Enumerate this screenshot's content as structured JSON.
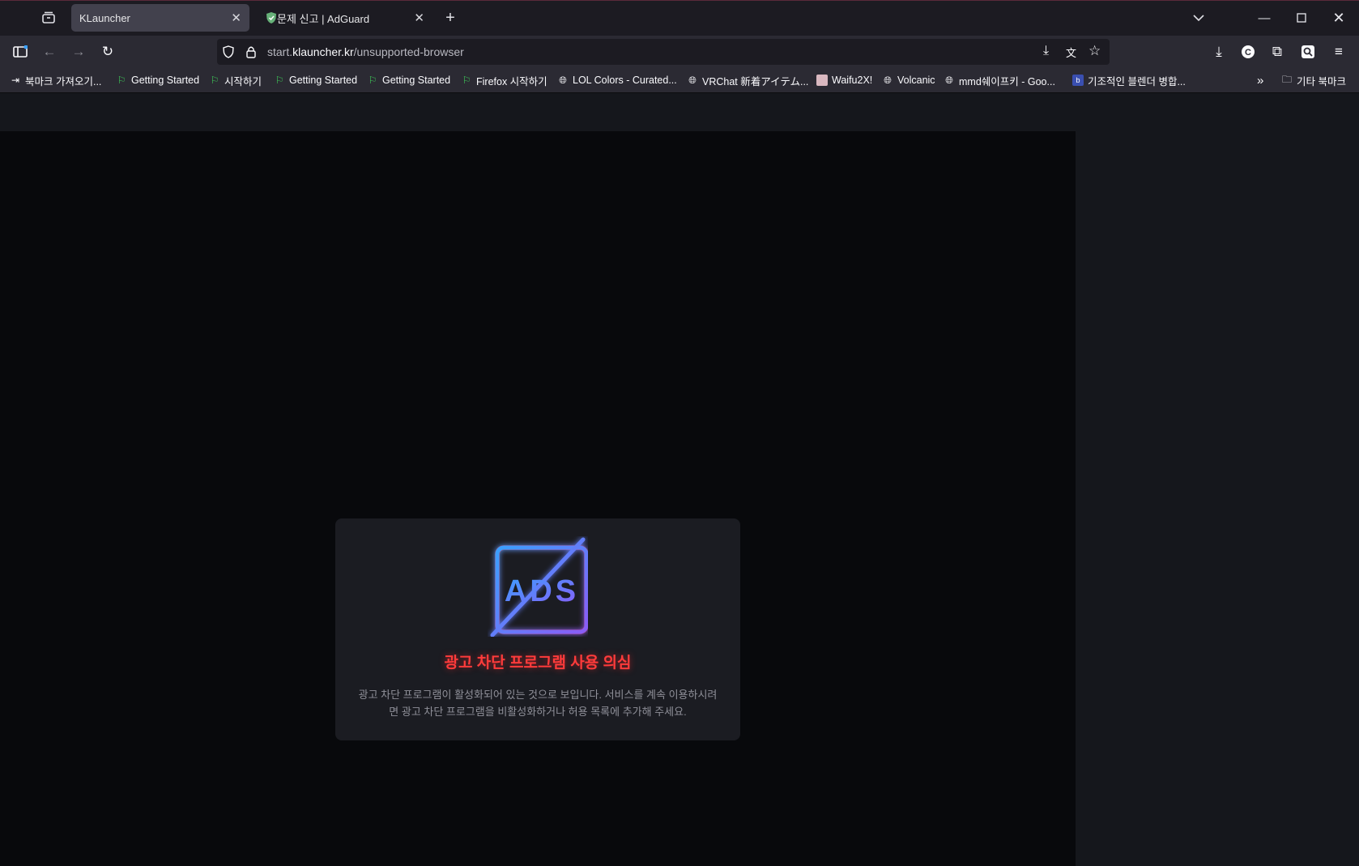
{
  "tabs": [
    {
      "title": "KLauncher",
      "active": true
    },
    {
      "title": "문제 신고 | AdGuard",
      "active": false
    }
  ],
  "address": {
    "prefix": "start.",
    "domain": "klauncher.kr",
    "path": "/unsupported-browser"
  },
  "bookmarks": [
    {
      "label": "북마크 가져오기...",
      "icon": "import-icon"
    },
    {
      "label": "Getting Started",
      "icon": "firefox-flag-icon"
    },
    {
      "label": "시작하기",
      "icon": "firefox-flag-icon"
    },
    {
      "label": "Getting Started",
      "icon": "firefox-flag-icon"
    },
    {
      "label": "Getting Started",
      "icon": "firefox-flag-icon"
    },
    {
      "label": "Firefox 시작하기",
      "icon": "firefox-flag-icon"
    },
    {
      "label": "LOL Colors - Curated...",
      "icon": "globe-icon"
    },
    {
      "label": "VRChat 新着アイテム...",
      "icon": "globe-icon"
    },
    {
      "label": "Waifu2X!",
      "icon": "waifu-icon"
    },
    {
      "label": "Volcanic",
      "icon": "globe-icon"
    },
    {
      "label": "mmd쉐이프키 - Goo...",
      "icon": "globe-icon"
    },
    {
      "label": "기조적인 블렌더 병합...",
      "icon": "app-icon"
    }
  ],
  "other_bookmarks": "기타 북마크",
  "notice": {
    "logo_text": "ADS",
    "title": "광고 차단 프로그램 사용 의심",
    "body_line1": "광고 차단 프로그램이 활성화되어 있는 것으로 보입니다. 서비스를 계속 이용하시려",
    "body_line2": "면 광고 차단 프로그램을 비활성화하거나 허용 목록에 추가해 주세요."
  },
  "colors": {
    "title_red": "#ff3b3b",
    "logo_blue": "#3aa0ff",
    "logo_violet": "#8a5cf6"
  }
}
